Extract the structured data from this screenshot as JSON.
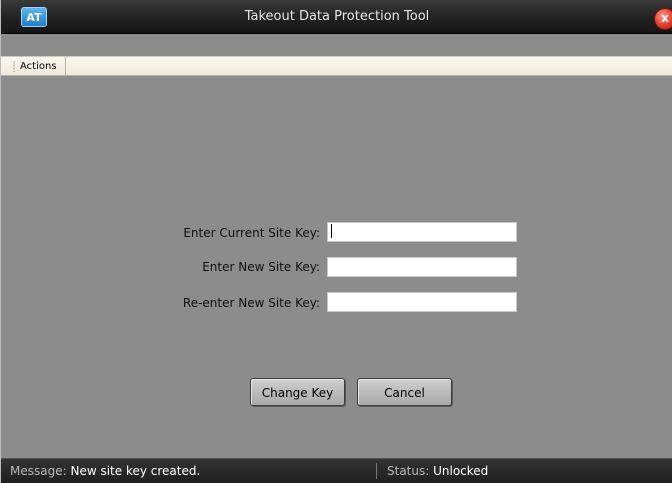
{
  "window": {
    "title": "Takeout Data Protection Tool",
    "logo_text": "AT",
    "close_label": "x"
  },
  "menu": {
    "items": [
      {
        "label": "Actions"
      }
    ]
  },
  "form": {
    "current_key_label": "Enter Current Site Key:",
    "current_key_value": "",
    "new_key_label": "Enter New Site Key:",
    "new_key_value": "",
    "reenter_key_label": "Re-enter New Site Key:",
    "reenter_key_value": ""
  },
  "buttons": {
    "change_key": "Change Key",
    "cancel": "Cancel"
  },
  "status_bar": {
    "message_label": "Message:",
    "message_value": "New site key created.",
    "status_label": "Status:",
    "status_value": "Unlocked"
  },
  "colors": {
    "background": "#8c8c8c",
    "titlebar": "#222222",
    "statusbar": "#2a2a2a",
    "logo": "#2a8fd8",
    "close": "#e23c2a"
  }
}
